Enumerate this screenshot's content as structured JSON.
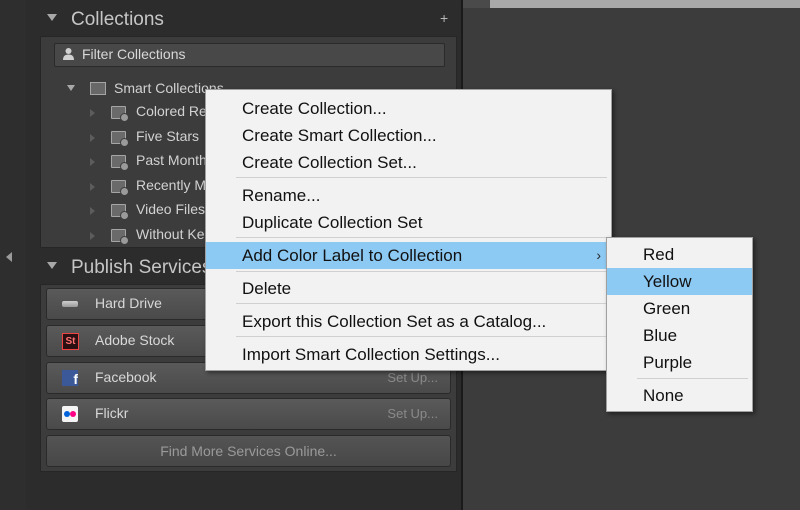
{
  "collections": {
    "title": "Collections",
    "add_icon": "+",
    "filter_placeholder": "Filter Collections",
    "smart_collections": {
      "label": "Smart Collections",
      "items": [
        "Colored Re",
        "Five Stars",
        "Past Month",
        "Recently M",
        "Video Files",
        "Without Ke"
      ]
    }
  },
  "publish_services": {
    "title": "Publish Services",
    "services": [
      {
        "name": "Hard Drive",
        "setup": "",
        "icon": "hard-drive-icon"
      },
      {
        "name": "Adobe Stock",
        "setup": "",
        "icon": "adobe-stock-icon"
      },
      {
        "name": "Facebook",
        "setup": "Set Up...",
        "icon": "facebook-icon"
      },
      {
        "name": "Flickr",
        "setup": "Set Up...",
        "icon": "flickr-icon"
      }
    ],
    "find_more": "Find More Services Online..."
  },
  "context_menu": {
    "items": [
      "Create Collection...",
      "Create Smart Collection...",
      "Create Collection Set...",
      "Rename...",
      "Duplicate Collection Set",
      "Add Color Label to Collection",
      "Delete",
      "Export this Collection Set as a Catalog...",
      "Import Smart Collection Settings..."
    ],
    "submenu_arrow": "›",
    "highlight_color": "#8dcaf3"
  },
  "color_submenu": {
    "items": [
      "Red",
      "Yellow",
      "Green",
      "Blue",
      "Purple",
      "None"
    ],
    "selected": "Yellow"
  },
  "icon": {
    "fb_glyph": "f",
    "stock_glyph": "St"
  }
}
